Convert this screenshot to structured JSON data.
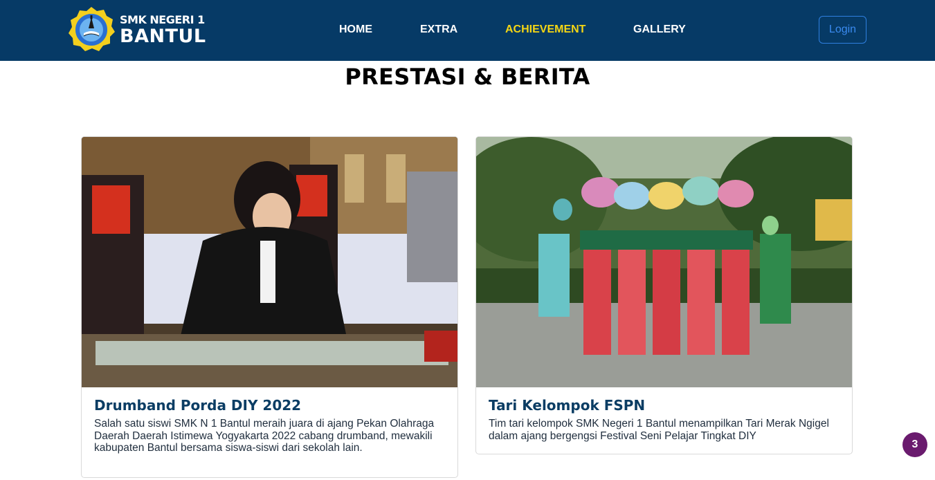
{
  "navbar": {
    "brand_line1": "SMK NEGERI 1",
    "brand_line2": "BANTUL",
    "links": [
      {
        "label": "HOME"
      },
      {
        "label": "EXTRA"
      },
      {
        "label": "ACHIEVEMENT",
        "active": true
      },
      {
        "label": "GALLERY"
      }
    ],
    "login_label": "Login",
    "colors": {
      "background": "#063a66",
      "active_link": "#f5d614",
      "login_border": "#2f7fe0"
    }
  },
  "main": {
    "title": "PRESTASI & BERITA",
    "cards": [
      {
        "title": "Drumband Porda DIY 2022",
        "text": "Salah satu siswi SMK N 1 Bantul meraih juara di ajang Pekan Olahraga Daerah Daerah Istimewa Yogyakarta 2022 cabang drumband, mewakili kabupaten Bantul bersama siswa-siswi dari sekolah lain."
      },
      {
        "title": "Tari Kelompok FSPN",
        "text": "Tim tari kelompok SMK Negeri 1 Bantul menampilkan Tari Merak Ngigel dalam ajang bergengsi Festival Seni Pelajar Tingkat DIY"
      }
    ]
  },
  "floating_badge": {
    "count": "3",
    "color": "#6a1b6e"
  }
}
